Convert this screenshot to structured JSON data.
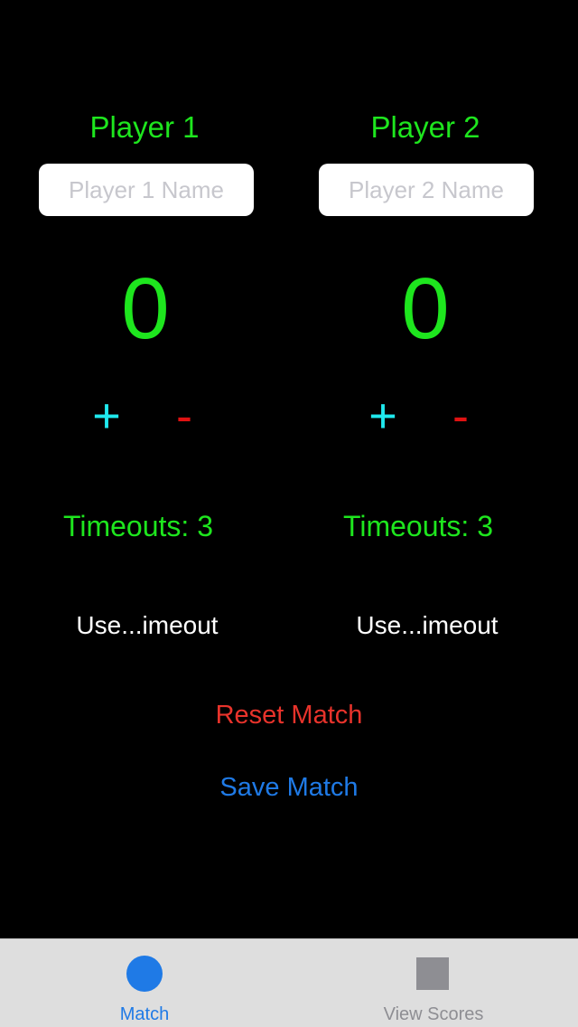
{
  "colors": {
    "background": "#000000",
    "title_green": "#1ee61e",
    "plus_cyan": "#1fe9ee",
    "minus_red": "#e01212",
    "reset_red": "#e8332b",
    "save_blue": "#1f7ae6",
    "tab_active": "#1f7ae6",
    "tab_inactive": "#8e8e93",
    "tab_bar_bg": "#dedede"
  },
  "players": [
    {
      "title": "Player 1",
      "name_value": "",
      "name_placeholder": "Player 1 Name",
      "score": "0",
      "plus_label": "+",
      "minus_label": "-",
      "timeouts_label": "Timeouts: 3",
      "use_timeout_label": "Use...imeout"
    },
    {
      "title": "Player 2",
      "name_value": "",
      "name_placeholder": "Player 2 Name",
      "score": "0",
      "plus_label": "+",
      "minus_label": "-",
      "timeouts_label": "Timeouts: 3",
      "use_timeout_label": "Use...imeout"
    }
  ],
  "actions": {
    "reset_label": "Reset Match",
    "save_label": "Save Match"
  },
  "tab_bar": {
    "tabs": [
      {
        "label": "Match",
        "icon": "circle-icon",
        "active": true
      },
      {
        "label": "View Scores",
        "icon": "square-icon",
        "active": false
      }
    ]
  }
}
